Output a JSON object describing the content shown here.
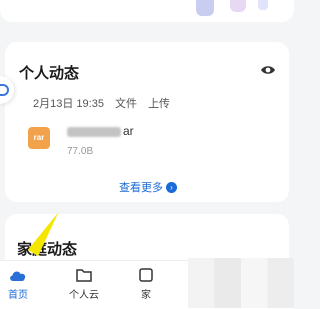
{
  "feed": {
    "title": "个人动态",
    "meta": {
      "date": "2月13日 19:35",
      "type": "文件",
      "action": "上传"
    },
    "file": {
      "icon_text": "rar",
      "name_visible": "ar",
      "size": "77.0B"
    },
    "view_more": "查看更多"
  },
  "family": {
    "title": "家庭动态"
  },
  "nav": {
    "items": [
      {
        "label": "首页",
        "active": true
      },
      {
        "label": "个人云",
        "active": false
      },
      {
        "label": "家",
        "active": false
      }
    ]
  },
  "colors": {
    "accent": "#1a6bd8",
    "file_icon": "#f2a24a",
    "pointer": "#f5e600"
  }
}
